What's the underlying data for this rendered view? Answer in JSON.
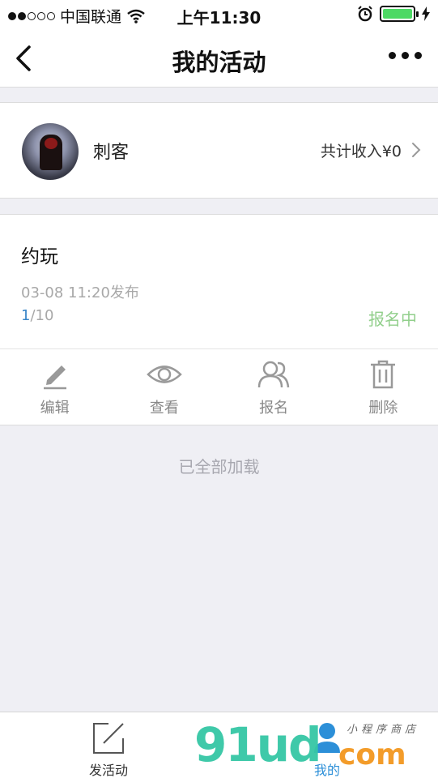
{
  "status_bar": {
    "carrier": "中国联通",
    "time": "上午11:30",
    "signal_icon": "signal-dots-icon",
    "wifi_icon": "wifi-icon",
    "alarm_icon": "alarm-icon",
    "battery_icon": "battery-icon",
    "charging_icon": "charging-bolt-icon",
    "battery_level": 1.0
  },
  "nav": {
    "title": "我的活动",
    "back_icon": "chevron-left-icon",
    "more_icon": "more-dots-icon"
  },
  "profile": {
    "name": "刺客",
    "income_label": "共计收入¥0",
    "chevron_icon": "chevron-right-icon"
  },
  "activity": {
    "title": "约玩",
    "published": "03-08 11:20发布",
    "count_current": "1",
    "count_total": "/10",
    "status": "报名中",
    "actions": [
      {
        "label": "编辑",
        "icon": "pencil-icon"
      },
      {
        "label": "查看",
        "icon": "eye-icon"
      },
      {
        "label": "报名",
        "icon": "users-icon"
      },
      {
        "label": "删除",
        "icon": "trash-icon"
      }
    ]
  },
  "list_footer": "已全部加载",
  "tab_bar": {
    "tabs": [
      {
        "label": "发活动",
        "icon": "compose-icon"
      },
      {
        "label": "我的",
        "icon": "person-icon",
        "active": true
      }
    ]
  },
  "watermark": {
    "logo": "91ud",
    "suffix": "com",
    "tagline": "小程序商店"
  },
  "colors": {
    "status_green": "#92cf8c",
    "accent_blue": "#2c8fd8",
    "battery_green": "#4cd964"
  }
}
